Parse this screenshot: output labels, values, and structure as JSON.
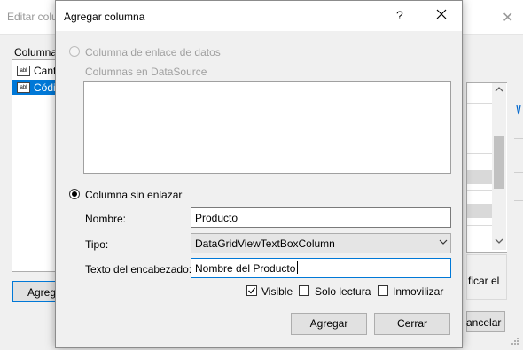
{
  "background_window": {
    "title": "Editar colu",
    "close_glyph": "✕",
    "columns_label": "Columna",
    "columns": [
      {
        "icon": "abl",
        "label": "Canti"
      },
      {
        "icon": "abl",
        "label": "Códi"
      }
    ],
    "add_button": "Agreg",
    "right_panel_text": "ficar el",
    "cancel_button": "ancelar"
  },
  "dialog": {
    "title": "Agregar columna",
    "help_glyph": "?",
    "bound_option": {
      "label": "Columna de enlace de datos",
      "selected": false,
      "enabled": false
    },
    "datasource_label": "Columnas en DataSource",
    "unbound_option": {
      "label": "Columna sin enlazar",
      "selected": true
    },
    "nombre": {
      "label": "Nombre:",
      "value": "Producto"
    },
    "tipo": {
      "label": "Tipo:",
      "value": "DataGridViewTextBoxColumn"
    },
    "header_text": {
      "label": "Texto del encabezado:",
      "value": "Nombre del Producto"
    },
    "visible": {
      "label": "Visible",
      "checked": true
    },
    "read_only": {
      "label": "Solo lectura",
      "checked": false
    },
    "freeze": {
      "label": "Inmovilizar",
      "checked": false
    },
    "add_button": "Agregar",
    "close_button": "Cerrar"
  },
  "colors": {
    "accent": "#0078d7",
    "disabled_text": "#a0a0a0",
    "button_face": "#e1e1e1"
  }
}
